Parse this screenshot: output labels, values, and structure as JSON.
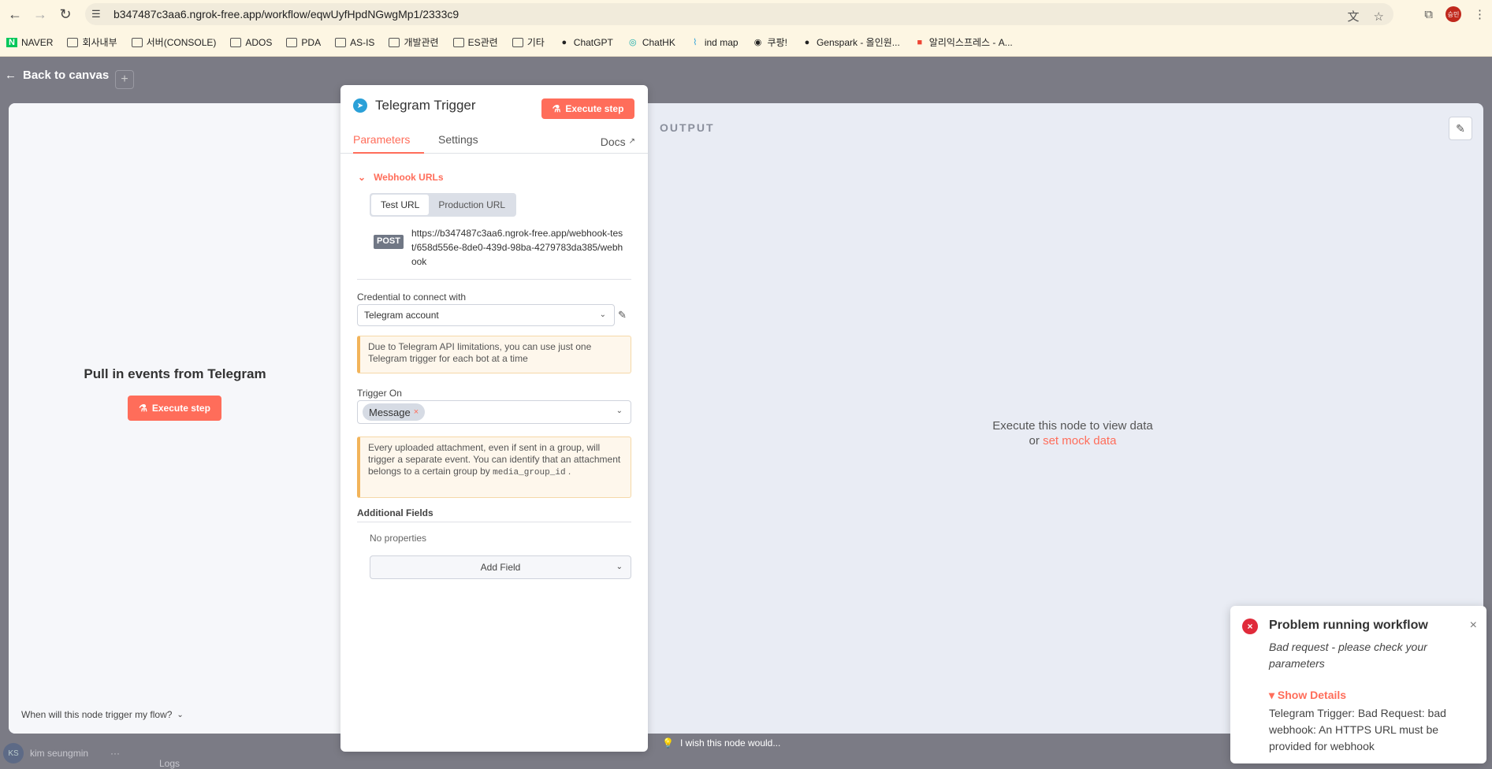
{
  "browser": {
    "url": "b347487c3aa6.ngrok-free.app/workflow/eqwUyfHpdNGwgMp1/2333c9",
    "profile_initials": "승민",
    "bookmarks": [
      {
        "label": "NAVER",
        "icon": "naver-icon"
      },
      {
        "label": "회사내부",
        "icon": "folder-icon"
      },
      {
        "label": "서버(CONSOLE)",
        "icon": "folder-icon"
      },
      {
        "label": "ADOS",
        "icon": "folder-icon"
      },
      {
        "label": "PDA",
        "icon": "folder-icon"
      },
      {
        "label": "AS-IS",
        "icon": "folder-icon"
      },
      {
        "label": "개발관련",
        "icon": "folder-icon"
      },
      {
        "label": "ES관련",
        "icon": "folder-icon"
      },
      {
        "label": "기타",
        "icon": "folder-icon"
      },
      {
        "label": "ChatGPT",
        "icon": "chatgpt-icon"
      },
      {
        "label": "ChatHK",
        "icon": "chathk-icon"
      },
      {
        "label": "ind map",
        "icon": "map-icon"
      },
      {
        "label": "쿠팡!",
        "icon": "globe-icon"
      },
      {
        "label": "Genspark - 올인원...",
        "icon": "genspark-icon"
      },
      {
        "label": "알리익스프레스 - A...",
        "icon": "aliexpress-icon"
      }
    ]
  },
  "app": {
    "back_label": "Back to canvas",
    "user_name": "kim seungmin",
    "user_initials": "KS",
    "logs_label": "Logs",
    "wish_label": "I wish this node would..."
  },
  "input_pane": {
    "title": "Pull in events from Telegram",
    "execute_label": "Execute step",
    "trigger_question": "When will this node trigger my flow?"
  },
  "node": {
    "title": "Telegram Trigger",
    "execute_label": "Execute step",
    "tabs": {
      "parameters": "Parameters",
      "settings": "Settings",
      "docs": "Docs"
    },
    "webhook": {
      "section_label": "Webhook URLs",
      "test_url_tab": "Test URL",
      "production_url_tab": "Production URL",
      "method": "POST",
      "url": "https://b347487c3aa6.ngrok-free.app/webhook-test/658d556e-8de0-439d-98ba-4279783da385/webhook"
    },
    "credential": {
      "label": "Credential to connect with",
      "value": "Telegram account"
    },
    "api_notice": "Due to Telegram API limitations, you can use just one Telegram trigger for each bot at a time",
    "trigger_on": {
      "label": "Trigger On",
      "chip": "Message"
    },
    "attachment_notice_text": "Every uploaded attachment, even if sent in a group, will trigger a separate event. You can identify that an attachment belongs to a certain group by",
    "attachment_notice_code": "media_group_id",
    "attachment_notice_end": ".",
    "additional_fields": {
      "label": "Additional Fields",
      "empty": "No properties",
      "add_label": "Add Field"
    }
  },
  "output": {
    "label": "OUTPUT",
    "empty_line1": "Execute this node to view data",
    "empty_or": "or",
    "mock_link": "set mock data"
  },
  "toast": {
    "title": "Problem running workflow",
    "message": "Bad request - please check your parameters",
    "details_label": "Show Details",
    "details_body": "Telegram Trigger: Bad Request: bad webhook: An HTTPS URL must be provided for webhook"
  },
  "colors": {
    "accent": "#ff6d5a",
    "error": "#e02a3a",
    "telegram": "#2aa0d8"
  }
}
